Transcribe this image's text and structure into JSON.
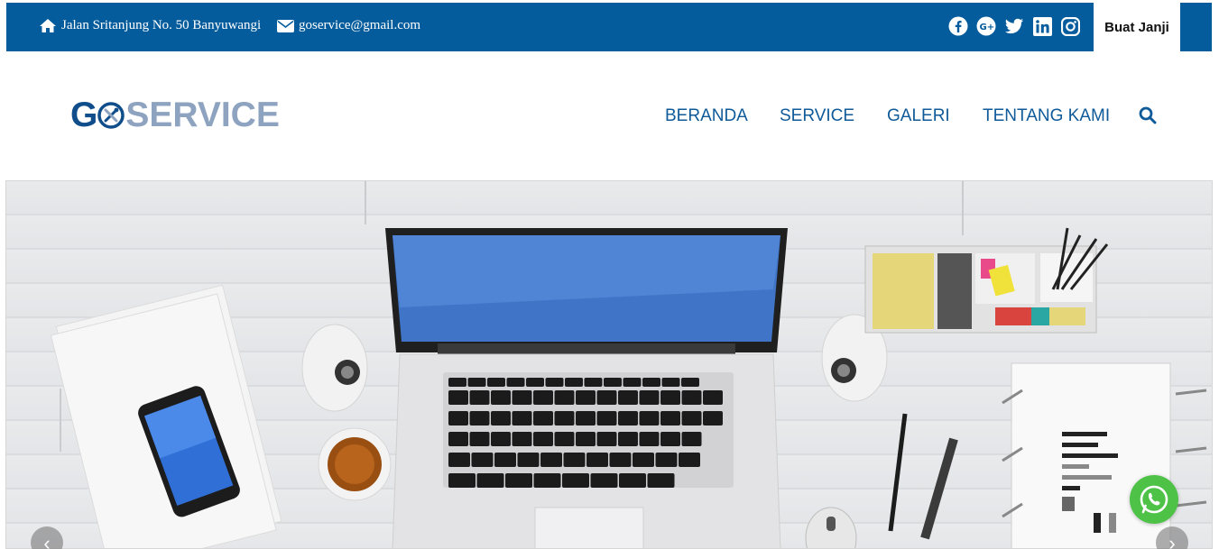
{
  "topbar": {
    "address": "Jalan Sritanjung No. 50 Banyuwangi",
    "email": "goservice@gmail.com",
    "cta_label": "Buat Janji",
    "socials": [
      "facebook-icon",
      "google-plus-icon",
      "twitter-icon",
      "linkedin-icon",
      "instagram-icon"
    ]
  },
  "header": {
    "logo_g": "G",
    "logo_rest": "SERVICE",
    "nav": [
      "BERANDA",
      "SERVICE",
      "GALERI",
      "TENTANG KAMI"
    ]
  },
  "carousel": {
    "prev_label": "‹",
    "next_label": "›"
  },
  "colors": {
    "brand": "#045c9c",
    "nav_text": "#0f5a99",
    "whatsapp": "#4dc247"
  }
}
